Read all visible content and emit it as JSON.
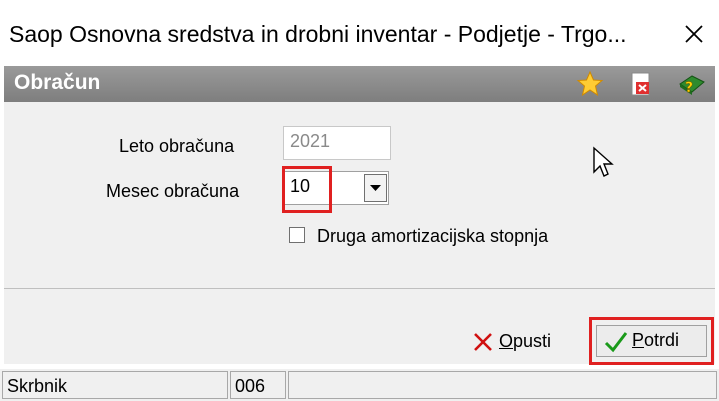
{
  "window": {
    "title": "Saop Osnovna sredstva in drobni inventar - Podjetje - Trgo...",
    "close_label": "×"
  },
  "header": {
    "title": "Obračun",
    "icons": [
      "star-icon",
      "pdf-icon",
      "help-book-icon"
    ]
  },
  "form": {
    "leto_label": "Leto obračuna",
    "leto_value": "2021",
    "mesec_label": "Mesec obračuna",
    "mesec_value": "10",
    "druga_label": "Druga amortizacijska stopnja",
    "druga_checked": false
  },
  "buttons": {
    "opusti_access": "O",
    "opusti_rest": "pusti",
    "potrdi_access": "P",
    "potrdi_rest": "otrdi"
  },
  "status": {
    "cell1": "Skrbnik",
    "cell2": "006",
    "cell3": ""
  },
  "colors": {
    "header_bg": "#8a8a8a",
    "highlight": "#e02020",
    "check_green": "#1a9a1a",
    "cancel_red": "#d01010"
  }
}
